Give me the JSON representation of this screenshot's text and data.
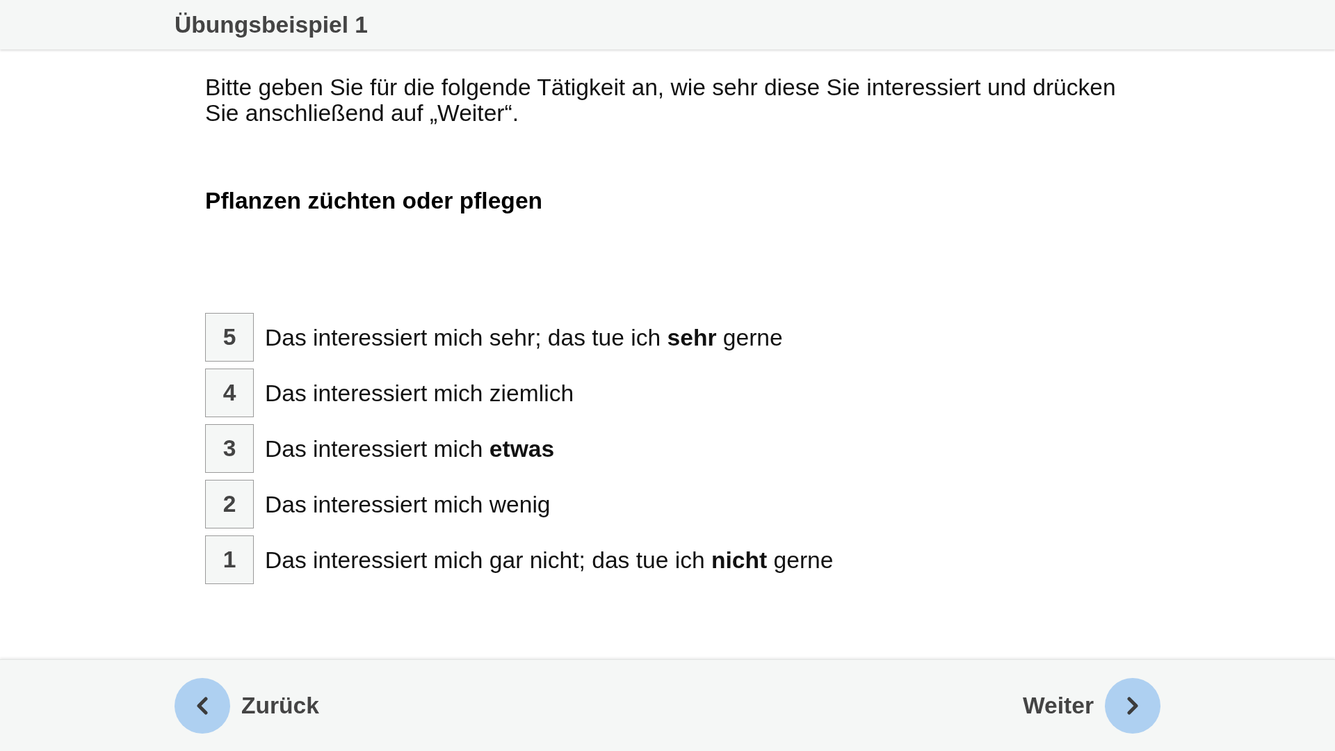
{
  "header": {
    "title": "Übungsbeispiel 1"
  },
  "instruction": "Bitte geben Sie für die folgende Tätigkeit an, wie sehr diese Sie interessiert und drücken Sie anschließend auf „Weiter“.",
  "item": "Pflanzen züchten oder pflegen",
  "options": [
    {
      "value": "5",
      "label": "Das interessiert mich sehr; das tue ich **sehr** gerne",
      "selected": false
    },
    {
      "value": "4",
      "label": "Das interessiert mich ziemlich",
      "selected": false
    },
    {
      "value": "3",
      "label": "Das interessiert mich **etwas**",
      "selected": false
    },
    {
      "value": "2",
      "label": "Das interessiert mich wenig",
      "selected": false
    },
    {
      "value": "1",
      "label": "Das interessiert mich gar nicht; das tue ich **nicht** gerne",
      "selected": false
    }
  ],
  "navigation": {
    "back": "Zurück",
    "next": "Weiter"
  }
}
